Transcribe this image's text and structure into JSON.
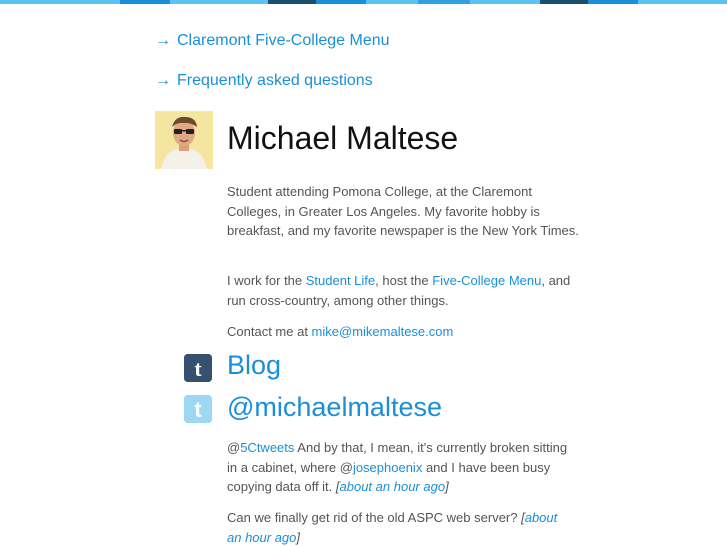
{
  "colors": {
    "link": "#1a8fd9",
    "text": "#555555",
    "heading": "#111111",
    "topbar": [
      "#5bc2f1",
      "#1a8fd9",
      "#1b4f6b",
      "#2fa0e0"
    ]
  },
  "nav": {
    "arrow": "→",
    "menu_link": "Claremont Five-College Menu",
    "faq_link": "Frequently asked questions"
  },
  "profile": {
    "name": "Michael Maltese",
    "avatar_icon": "user-photo",
    "bio": "Student attending Pomona College, at the Claremont Colleges, in Greater Los Angeles. My favorite hobby is breakfast, and my favorite newspaper is the New York Times.",
    "work": {
      "prefix": "I work for the ",
      "link1": "Student Life",
      "middle": ", host the ",
      "link2": "Five-College Menu",
      "suffix": ", and run cross-country, among other things."
    },
    "contact": {
      "prefix": "Contact me at ",
      "email": "mike@mikemaltese.com"
    }
  },
  "sections": {
    "blog": {
      "icon": "tumblr-icon",
      "title": "Blog"
    },
    "twitter": {
      "icon": "twitter-icon",
      "title": "@michaelmaltese"
    }
  },
  "tweets": [
    {
      "mention1": "@",
      "mention1_link": "5Ctweets",
      "text1": " And by that, I mean, it's currently broken sitting in a cabinet, where @",
      "mention2_link": "josephoenix",
      "text2": " and I have been busy copying data off it. ",
      "time_open": "[",
      "time": "about an hour ago",
      "time_close": "]"
    },
    {
      "text1": "Can we finally get rid of the old ASPC web server? ",
      "time_open": "[",
      "time": "about an hour ago",
      "time_close": "]"
    }
  ]
}
